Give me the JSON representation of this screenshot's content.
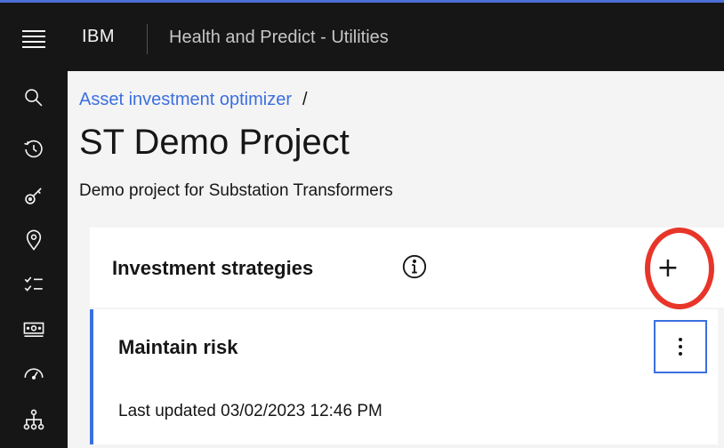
{
  "header": {
    "brand": "IBM",
    "app_title": "Health and Predict - Utilities",
    "menu_icon": "hamburger-menu-icon"
  },
  "sidenav": {
    "icons": [
      "search-icon",
      "recent-history-icon",
      "asset-key-icon",
      "location-pin-icon",
      "checklist-icon",
      "money-icon",
      "gauge-icon",
      "hierarchy-icon"
    ]
  },
  "breadcrumb": {
    "link": "Asset investment optimizer",
    "separator": "/"
  },
  "page": {
    "title": "ST Demo Project",
    "description": "Demo project for Substation Transformers"
  },
  "strategies": {
    "title": "Investment strategies",
    "info_icon": "information-icon",
    "add_label": "+",
    "highlight_color": "#e8352a"
  },
  "strategy_item": {
    "name": "Maintain risk",
    "last_updated": "Last updated 03/02/2023 12:46 PM",
    "overflow_icon": "overflow-menu-icon",
    "accent_color": "#3b6fe0"
  }
}
